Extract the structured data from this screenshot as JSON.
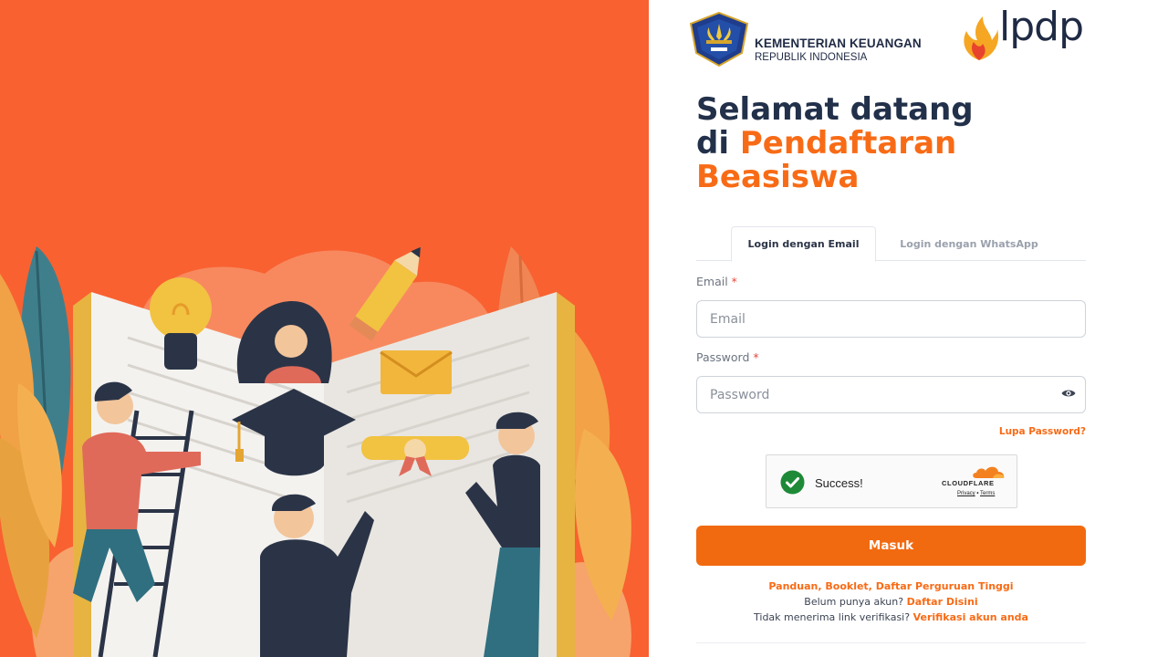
{
  "brand": {
    "ministry_line1": "KEMENTERIAN KEUANGAN",
    "ministry_line2": "REPUBLIK INDONESIA",
    "lpdp_wordmark": "lpdp"
  },
  "heading": {
    "line1": "Selamat datang",
    "line2_prefix": "di ",
    "line2_accent": "Pendaftaran",
    "line3_accent": "Beasiswa"
  },
  "tabs": [
    {
      "label": "Login dengan Email",
      "active": true
    },
    {
      "label": "Login dengan WhatsApp",
      "active": false
    }
  ],
  "form": {
    "email_label": "Email",
    "email_placeholder": "Email",
    "email_value": "",
    "password_label": "Password",
    "password_placeholder": "Password",
    "password_value": "",
    "required_mark": "*",
    "forgot_label": "Lupa Password?",
    "submit_label": "Masuk"
  },
  "captcha": {
    "status": "Success!",
    "provider": "CLOUDFLARE",
    "privacy": "Privacy",
    "separator": "•",
    "terms": "Terms"
  },
  "footer": {
    "guide_link": "Panduan, Booklet, Daftar Perguruan Tinggi",
    "no_account_text": "Belum punya akun?",
    "register_link": "Daftar Disini",
    "no_verify_text": "Tidak menerima link verifikasi?",
    "verify_link": "Verifikasi akun anda"
  },
  "icons": {
    "password_toggle": "eye-icon",
    "captcha_status": "check-circle-icon",
    "captcha_logo": "cloudflare-cloud-icon",
    "ministry_emblem": "kemenkeu-emblem-icon",
    "lpdp_logo": "lpdp-flame-icon"
  },
  "colors": {
    "hero_background": "#f96131",
    "accent": "#f86b16",
    "submit_button": "#f26a10",
    "heading_text": "#22304a",
    "required_mark": "#e5483b",
    "captcha_success": "#1e8a38"
  }
}
